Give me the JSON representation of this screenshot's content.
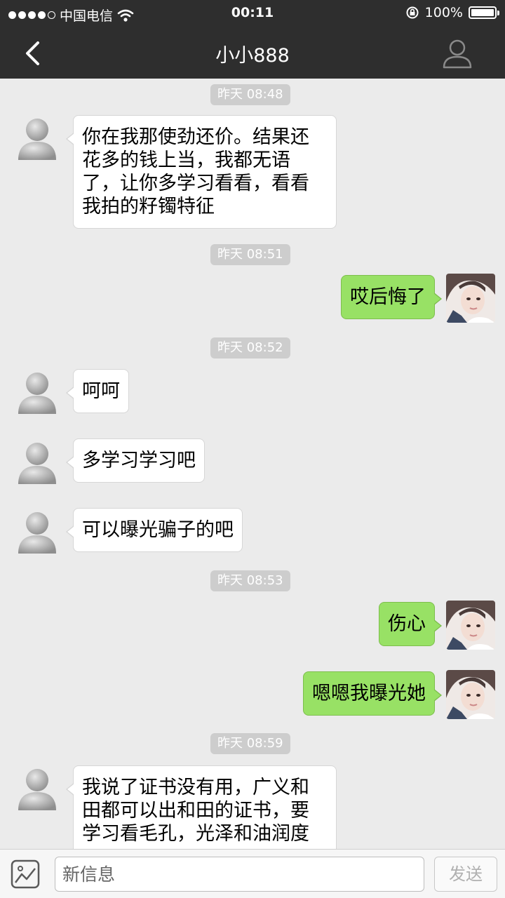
{
  "statusbar": {
    "carrier": "中国电信",
    "time": "00:11",
    "battery": "100%",
    "signal_bars": 4
  },
  "header": {
    "title": "小小888"
  },
  "messages": [
    {
      "type": "time",
      "text": "昨天 08:48"
    },
    {
      "type": "incoming",
      "lines": [
        "你在我那使劲还价。结果还",
        "花多的钱上当，我都无语",
        "了，让你多学习看看，看看",
        "我拍的籽镯特征"
      ]
    },
    {
      "type": "time",
      "text": "昨天 08:51"
    },
    {
      "type": "outgoing",
      "lines": [
        "哎后悔了"
      ]
    },
    {
      "type": "time",
      "text": "昨天 08:52"
    },
    {
      "type": "incoming",
      "lines": [
        "呵呵"
      ]
    },
    {
      "type": "incoming",
      "lines": [
        "多学习学习吧"
      ]
    },
    {
      "type": "incoming",
      "lines": [
        "可以曝光骗子的吧"
      ]
    },
    {
      "type": "time",
      "text": "昨天 08:53"
    },
    {
      "type": "outgoing",
      "lines": [
        "伤心"
      ]
    },
    {
      "type": "outgoing",
      "lines": [
        "嗯嗯我曝光她"
      ]
    },
    {
      "type": "time",
      "text": "昨天 08:59"
    },
    {
      "type": "incoming",
      "lines": [
        "我说了证书没有用，广义和",
        "田都可以出和田的证书，要",
        "学习看毛孔，光泽和油润度"
      ]
    }
  ],
  "input": {
    "placeholder": "新信息",
    "send_label": "发送"
  },
  "colors": {
    "bar": "#2e2e2e",
    "background": "#ebebeb",
    "outgoing_bubble": "#98e165",
    "incoming_bubble": "#ffffff"
  }
}
